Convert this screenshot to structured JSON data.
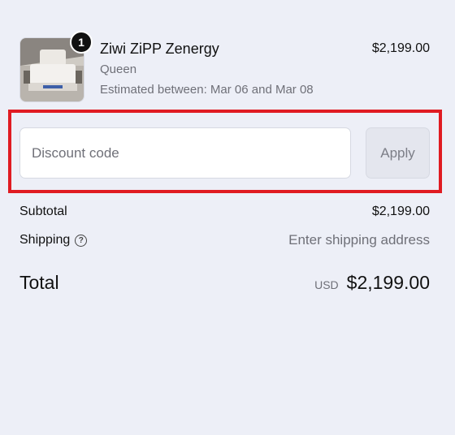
{
  "product": {
    "quantity": "1",
    "title": "Ziwi ZiPP Zenergy",
    "variant": "Queen",
    "estimate": "Estimated between: Mar 06 and Mar 08",
    "price": "$2,199.00",
    "image_icon": "bed-product-image"
  },
  "discount": {
    "placeholder": "Discount code",
    "apply_label": "Apply",
    "highlight_color": "#e01b22"
  },
  "summary": {
    "subtotal_label": "Subtotal",
    "subtotal_value": "$2,199.00",
    "shipping_label": "Shipping",
    "shipping_help_icon": "question-circle-icon",
    "shipping_value": "Enter shipping address",
    "total_label": "Total",
    "currency": "USD",
    "total_value": "$2,199.00"
  }
}
